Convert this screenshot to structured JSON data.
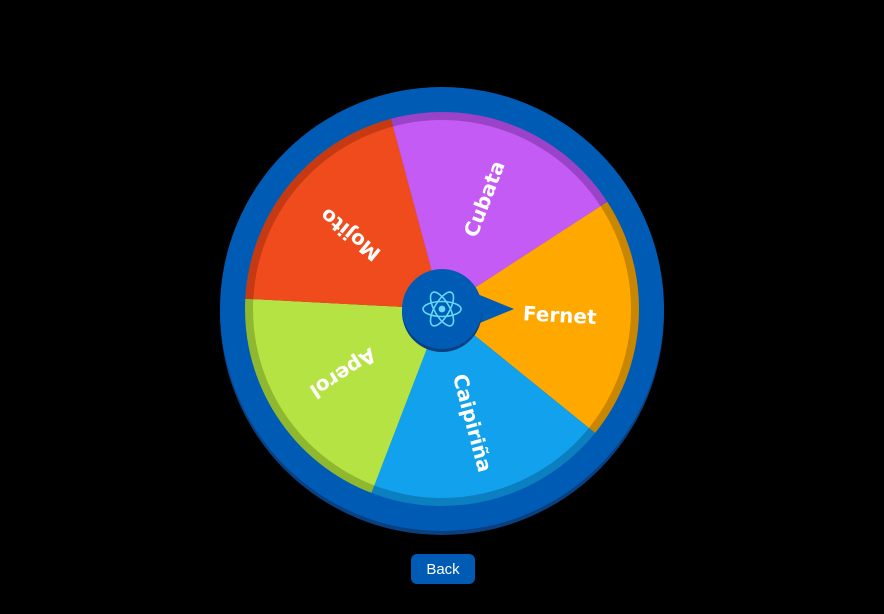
{
  "wheel": {
    "slices": [
      {
        "label": "Fernet",
        "color": "#ffa800",
        "shade": "#c98600"
      },
      {
        "label": "Caipiriña",
        "color": "#12a1ec",
        "shade": "#0b7fc0"
      },
      {
        "label": "Aperol",
        "color": "#b4e343",
        "shade": "#8fb830"
      },
      {
        "label": "Mojito",
        "color": "#f04b1d",
        "shade": "#c53a12"
      },
      {
        "label": "Cubata",
        "color": "#c45bf5",
        "shade": "#9a42c8"
      }
    ],
    "rim_color": "#005bb5",
    "rim_shadow": "#0a3f80",
    "hub_color": "#005bb5",
    "hub_icon": "react-atom-icon",
    "hub_icon_color": "#61dafb"
  },
  "back_button": {
    "label": "Back",
    "color": "#005bb5"
  }
}
